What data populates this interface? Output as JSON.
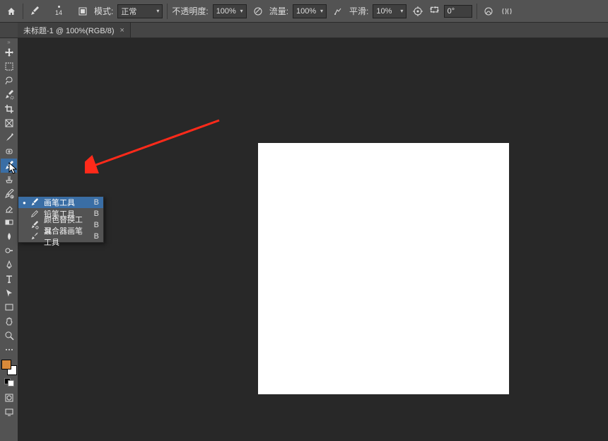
{
  "options_bar": {
    "brush_size": "14",
    "mode_label": "模式:",
    "mode_value": "正常",
    "opacity_label": "不透明度:",
    "opacity_value": "100%",
    "flow_label": "流量:",
    "flow_value": "100%",
    "smoothing_label": "平滑:",
    "smoothing_value": "10%",
    "angle_symbol": "⮔",
    "angle_value": "0°"
  },
  "tab": {
    "title": "未标题-1 @ 100%(RGB/8)",
    "close": "×"
  },
  "flyout": {
    "items": [
      {
        "label": "画笔工具",
        "shortcut": "B",
        "selected": true
      },
      {
        "label": "铅笔工具",
        "shortcut": "B",
        "selected": false
      },
      {
        "label": "颜色替换工具",
        "shortcut": "B",
        "selected": false
      },
      {
        "label": "混合器画笔工具",
        "shortcut": "B",
        "selected": false
      }
    ]
  },
  "colors": {
    "foreground": "#d98a3a",
    "background": "#ffffff"
  }
}
